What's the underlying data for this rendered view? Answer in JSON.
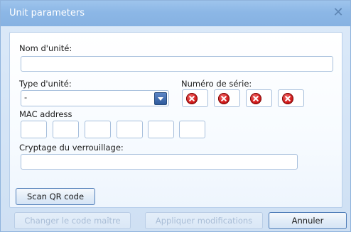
{
  "window": {
    "title": "Unit parameters",
    "close_glyph": "✕"
  },
  "form": {
    "unit_name_label": "Nom d'unité:",
    "unit_name_value": "",
    "unit_type_label": "Type d'unité:",
    "unit_type_value": "-",
    "serial_label": "Numéro de série:",
    "serial_status_icon": "error-icon",
    "serial_box_count": 4,
    "mac_label": "MAC address",
    "mac_values": [
      "",
      "",
      "",
      "",
      "",
      ""
    ],
    "lock_encryption_label": "Cryptage du verrouillage:",
    "lock_encryption_value": ""
  },
  "buttons": {
    "scan_qr": "Scan QR code",
    "change_master_code": "Changer le code maître",
    "apply_changes": "Appliquer modifications",
    "cancel": "Annuler"
  },
  "colors": {
    "titlebar": "#8cb7e6",
    "error": "#d21b1b",
    "border": "#a7bfdc"
  }
}
